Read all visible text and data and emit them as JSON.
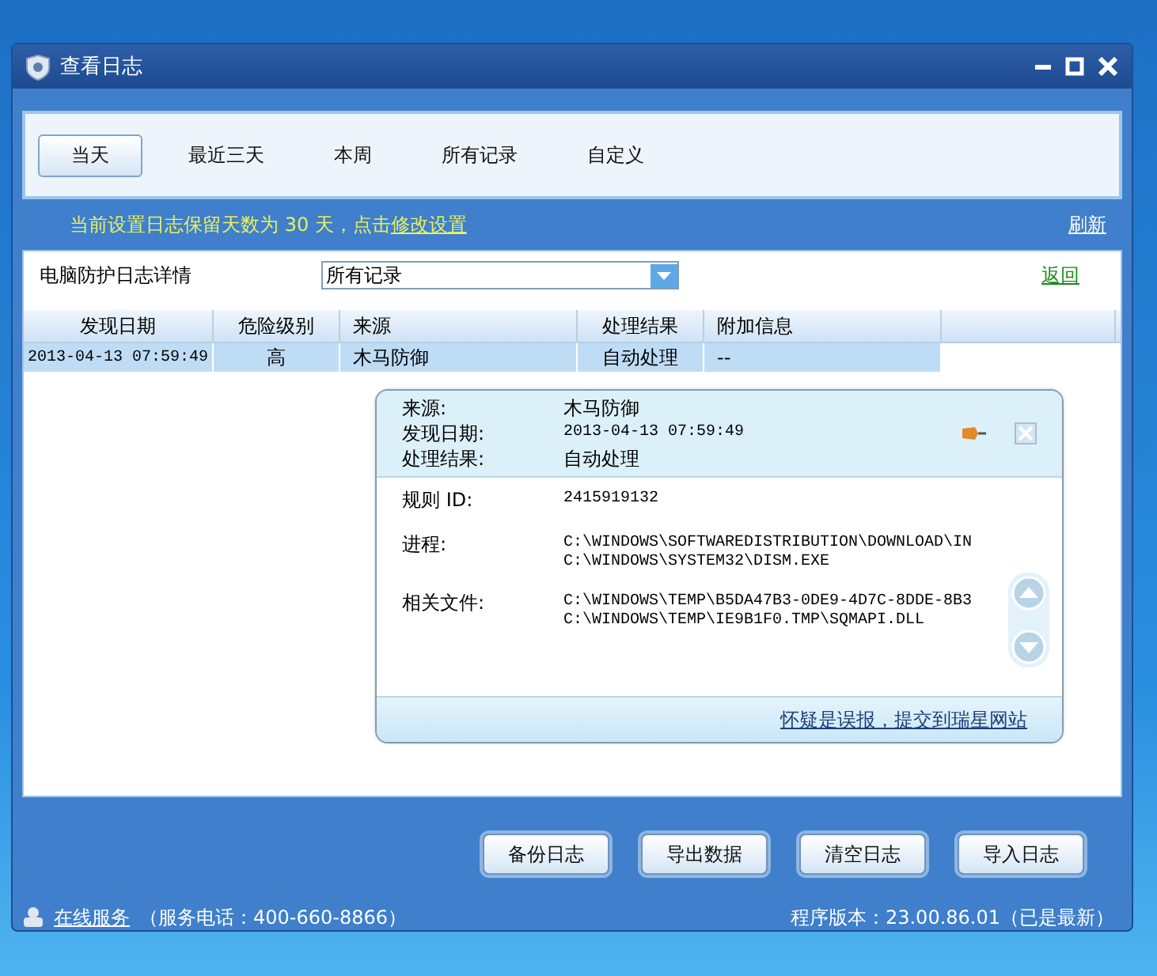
{
  "window": {
    "title": "查看日志"
  },
  "filters": [
    {
      "label": "当天",
      "selected": true
    },
    {
      "label": "最近三天",
      "selected": false
    },
    {
      "label": "本周",
      "selected": false
    },
    {
      "label": "所有记录",
      "selected": false
    },
    {
      "label": "自定义",
      "selected": false
    }
  ],
  "notice": {
    "text": "当前设置日志保留天数为 30 天，点击",
    "link": "修改设置"
  },
  "refresh_link": "刷新",
  "log_header": {
    "label": "电脑防护日志详情",
    "dropdown": {
      "value": "所有记录"
    },
    "back_link": "返回"
  },
  "table": {
    "columns": [
      "发现日期",
      "危险级别",
      "来源",
      "处理结果",
      "附加信息"
    ],
    "rows": [
      {
        "cells": [
          "2013-04-13 07:59:49",
          "高",
          "木马防御",
          "自动处理",
          "--"
        ],
        "selected": true
      }
    ]
  },
  "detail_popup": {
    "summary": [
      {
        "label": "来源:",
        "value": "木马防御",
        "kind": "text"
      },
      {
        "label": "发现日期:",
        "value": "2013-04-13 07:59:49",
        "kind": "mono"
      },
      {
        "label": "处理结果:",
        "value": "自动处理",
        "kind": "text"
      }
    ],
    "fields": [
      {
        "label": "规则 ID:",
        "lines": [
          "2415919132"
        ]
      },
      {
        "label": "进程:",
        "lines": [
          "C:\\WINDOWS\\SOFTWAREDISTRIBUTION\\DOWNLOAD\\IN",
          "C:\\WINDOWS\\SYSTEM32\\DISM.EXE"
        ]
      },
      {
        "label": "相关文件:",
        "lines": [
          "C:\\WINDOWS\\TEMP\\B5DA47B3-0DE9-4D7C-8DDE-8B3",
          "C:\\WINDOWS\\TEMP\\IE9B1F0.TMP\\SQMAPI.DLL"
        ]
      }
    ],
    "report_link": "怀疑是误报，提交到瑞星网站"
  },
  "buttons": [
    "备份日志",
    "导出数据",
    "清空日志",
    "导入日志"
  ],
  "status_bar": {
    "service_link": "在线服务",
    "phone": "（服务电话：400-660-8866）",
    "version": "程序版本：23.00.86.01（已是最新）"
  }
}
